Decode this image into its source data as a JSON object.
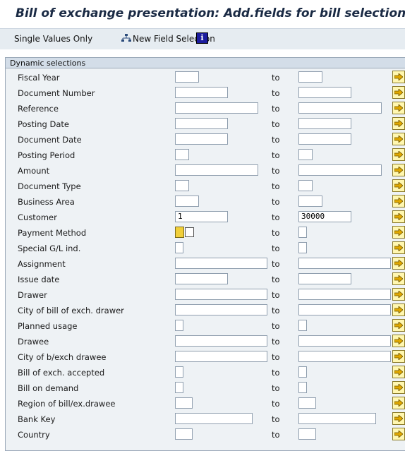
{
  "window": {
    "title": "Bill of exchange presentation: Add.fields for bill selection"
  },
  "toolbar": {
    "single_values": "Single Values Only",
    "new_field_selection": "New Field Selection"
  },
  "panel": {
    "header": "Dynamic selections",
    "to_label": "to",
    "rows": [
      {
        "label": "Fiscal Year",
        "from": "",
        "to": ""
      },
      {
        "label": "Document Number",
        "from": "",
        "to": ""
      },
      {
        "label": "Reference",
        "from": "",
        "to": ""
      },
      {
        "label": "Posting Date",
        "from": "",
        "to": ""
      },
      {
        "label": "Document Date",
        "from": "",
        "to": ""
      },
      {
        "label": "Posting Period",
        "from": "",
        "to": ""
      },
      {
        "label": "Amount",
        "from": "",
        "to": ""
      },
      {
        "label": "Document Type",
        "from": "",
        "to": ""
      },
      {
        "label": "Business Area",
        "from": "",
        "to": ""
      },
      {
        "label": "Customer",
        "from": "1",
        "to": "30000"
      },
      {
        "label": "Payment Method",
        "from": "",
        "to": ""
      },
      {
        "label": "Special G/L ind.",
        "from": "",
        "to": ""
      },
      {
        "label": "Assignment",
        "from": "",
        "to": ""
      },
      {
        "label": "Issue date",
        "from": "",
        "to": ""
      },
      {
        "label": "Drawer",
        "from": "",
        "to": ""
      },
      {
        "label": "City of bill of exch. drawer",
        "from": "",
        "to": ""
      },
      {
        "label": "Planned usage",
        "from": "",
        "to": ""
      },
      {
        "label": "Drawee",
        "from": "",
        "to": ""
      },
      {
        "label": "City of b/exch drawee",
        "from": "",
        "to": ""
      },
      {
        "label": "Bill of exch. accepted",
        "from": "",
        "to": ""
      },
      {
        "label": "Bill on demand",
        "from": "",
        "to": ""
      },
      {
        "label": "Region of bill/ex.drawee",
        "from": "",
        "to": ""
      },
      {
        "label": "Bank Key",
        "from": "",
        "to": ""
      },
      {
        "label": "Country",
        "from": "",
        "to": ""
      }
    ]
  },
  "icons": {
    "new_field_selection": "hierarchy-icon",
    "info": "info-icon",
    "multiple_selection": "arrow-right-icon"
  },
  "colors": {
    "toolbar_bg": "#e6ecf1",
    "panel_header_bg": "#d3dde8",
    "arrow_button_bg": "#fff7b0",
    "arrow_fill": "#e0a800"
  }
}
